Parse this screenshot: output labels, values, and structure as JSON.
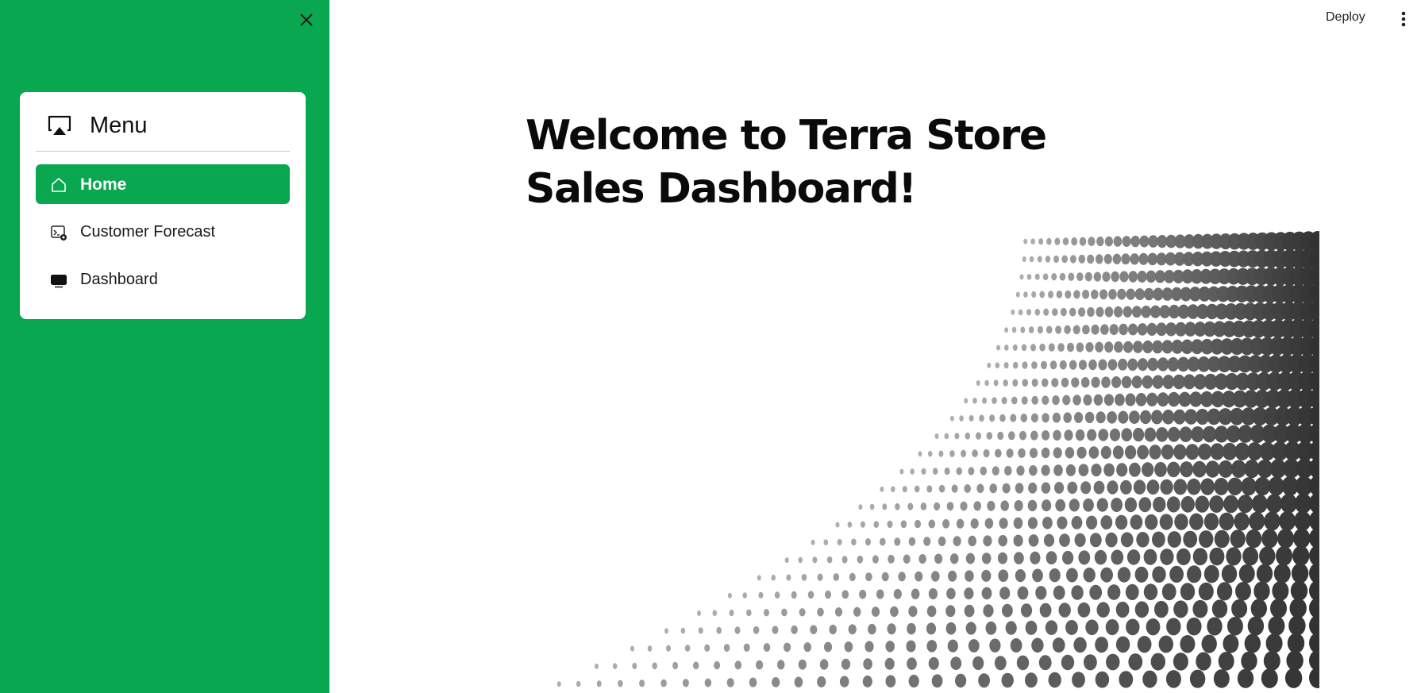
{
  "sidebar": {
    "background": "#09a750",
    "menu": {
      "title": "Menu",
      "icon": "airplay-icon",
      "items": [
        {
          "label": "Home",
          "icon": "home-icon",
          "active": true
        },
        {
          "label": "Customer Forecast",
          "icon": "image-settings-icon",
          "active": false
        },
        {
          "label": "Dashboard",
          "icon": "monitor-icon",
          "active": false
        }
      ]
    }
  },
  "topbar": {
    "deploy_label": "Deploy"
  },
  "main": {
    "title": "Welcome to Terra Store Sales Dashboard!",
    "hero_image": "halftone-dot-wave-image"
  }
}
